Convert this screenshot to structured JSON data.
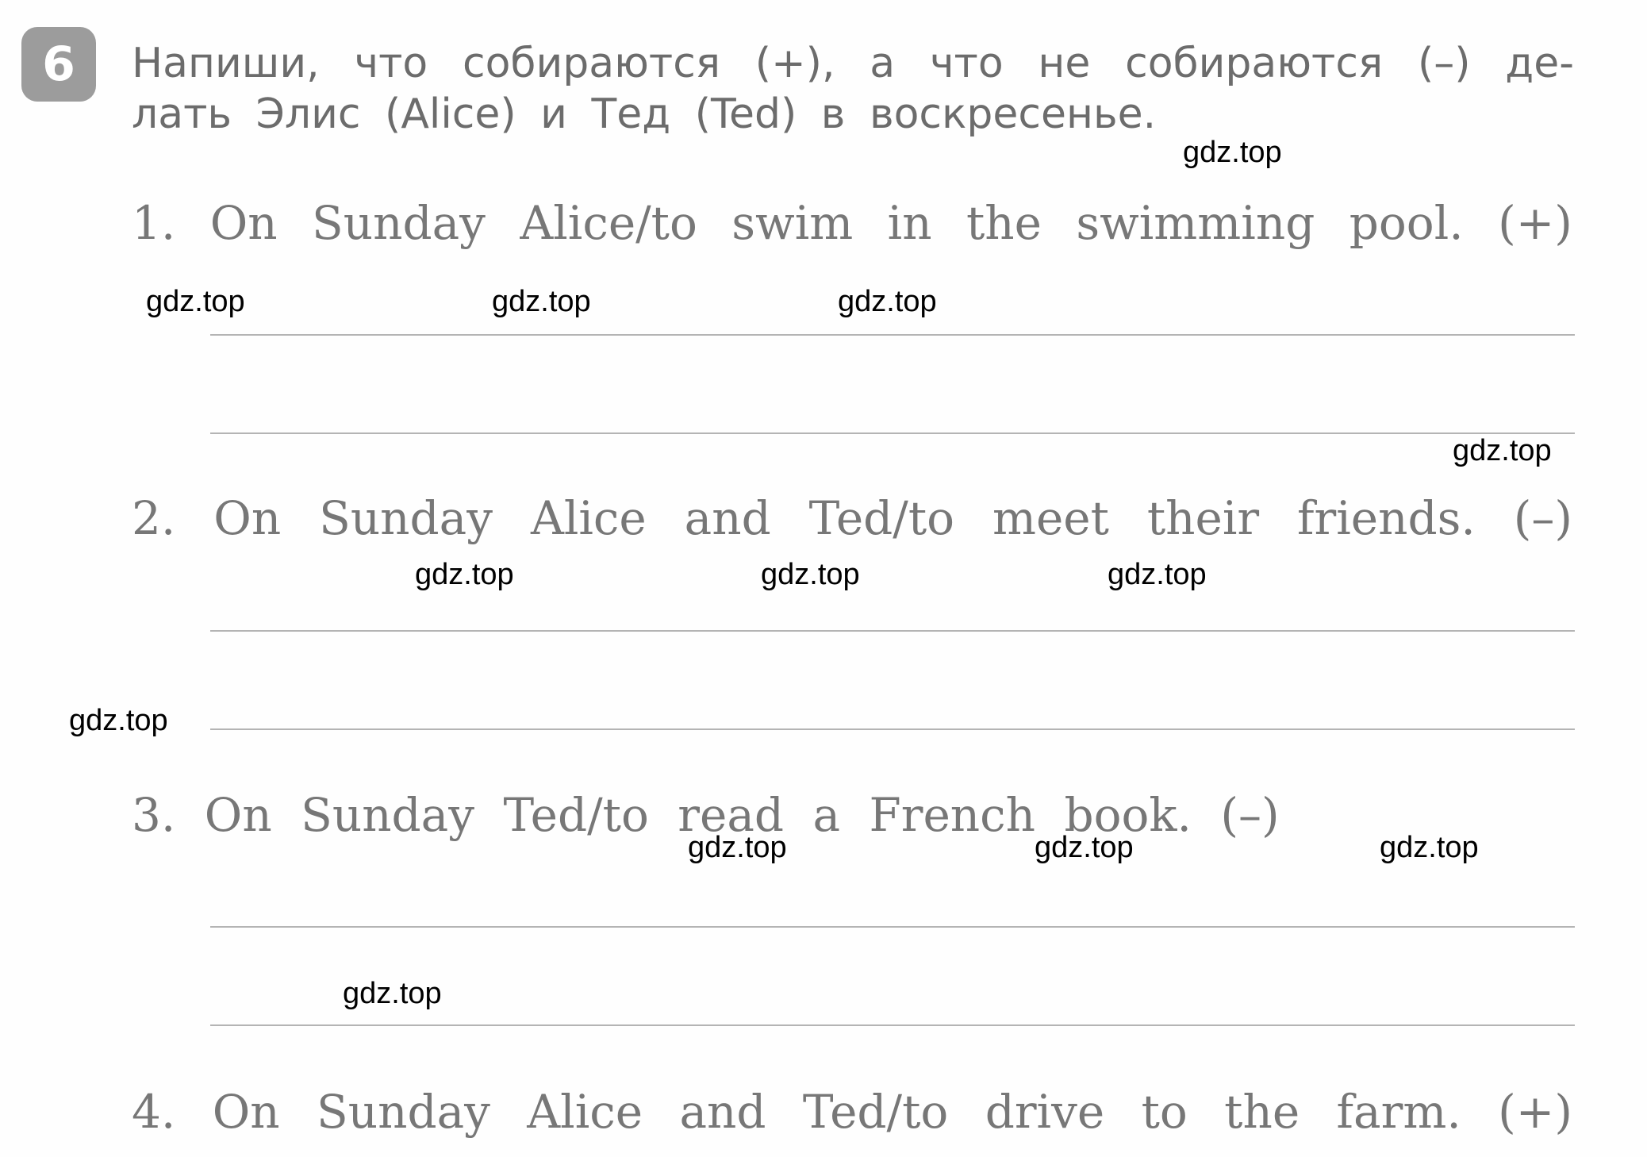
{
  "exercise": {
    "number": "6",
    "instruction_lines": [
      "Напиши, что собираются (+), а что не собираются (–) де-",
      "лать Элис (Alice) и Тед (Ted) в воскресенье."
    ]
  },
  "tasks": [
    {
      "text": "1. On Sunday Alice/to swim in the swimming pool. (+)",
      "answer_lines": [
        "",
        ""
      ]
    },
    {
      "text": "2. On Sunday Alice and Ted/to meet their friends. (–)",
      "answer_lines": [
        "",
        ""
      ]
    },
    {
      "text": "3. On Sunday Ted/to read a French book. (–)",
      "answer_lines": [
        "",
        ""
      ]
    },
    {
      "text": "4. On Sunday Alice and Ted/to drive to the farm. (+)",
      "answer_lines": []
    }
  ],
  "watermark": {
    "text": "gdz.top",
    "count": 13
  },
  "colors": {
    "badge_bg": "#9c9c9c",
    "instruction_text": "#6c6c6c",
    "task_text": "#777777",
    "answer_line": "#b4b4b4",
    "watermark_text": "#000000"
  }
}
